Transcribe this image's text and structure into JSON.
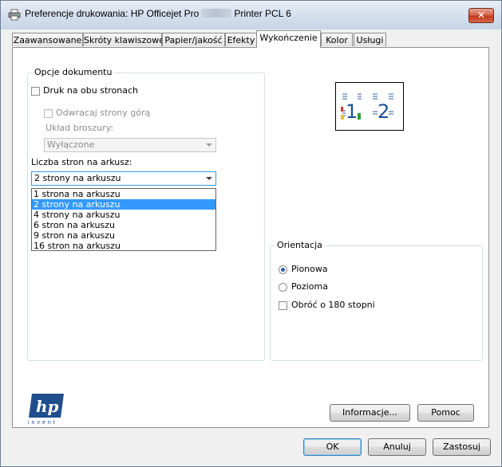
{
  "window": {
    "title_prefix": "Preferencje drukowania: HP Officejet Pro",
    "title_suffix": "Printer PCL 6",
    "close_label": "✕"
  },
  "tabs": [
    {
      "label": "Zaawansowane"
    },
    {
      "label": "Skróty klawiszowe"
    },
    {
      "label": "Papier/jakość"
    },
    {
      "label": "Efekty"
    },
    {
      "label": "Wykończenie",
      "active": true
    },
    {
      "label": "Kolor"
    },
    {
      "label": "Usługi"
    }
  ],
  "document_options": {
    "legend": "Opcje dokumentu",
    "duplex_label": "Druk na obu stronach",
    "duplex_checked": false,
    "flip_label": "Odwracaj strony górą",
    "flip_checked": false,
    "booklet_label": "Układ broszury:",
    "booklet_value": "Wyłączone",
    "pages_per_sheet_label": "Liczba stron na arkusz:",
    "pages_per_sheet_value": "2 strony na arkuszu",
    "pages_per_sheet_options": [
      "1 strona na arkuszu",
      "2 strony na arkuszu",
      "4 strony na arkuszu",
      "6 stron na arkuszu",
      "9 stron na arkuszu",
      "16 stron na arkuszu"
    ],
    "selected_index": 1
  },
  "preview": {
    "page1": "1",
    "page2": "2"
  },
  "orientation": {
    "legend": "Orientacja",
    "portrait_label": "Pionowa",
    "landscape_label": "Pozioma",
    "rotate_label": "Obróć o 180 stopni",
    "selected": "portrait",
    "rotate_checked": false
  },
  "logo": {
    "text": "hp",
    "tagline": "invent",
    "brand_color": "#1f4e8c"
  },
  "buttons": {
    "info": "Informacje...",
    "help": "Pomoc",
    "ok": "OK",
    "cancel": "Anuluj",
    "apply": "Zastosuj"
  }
}
